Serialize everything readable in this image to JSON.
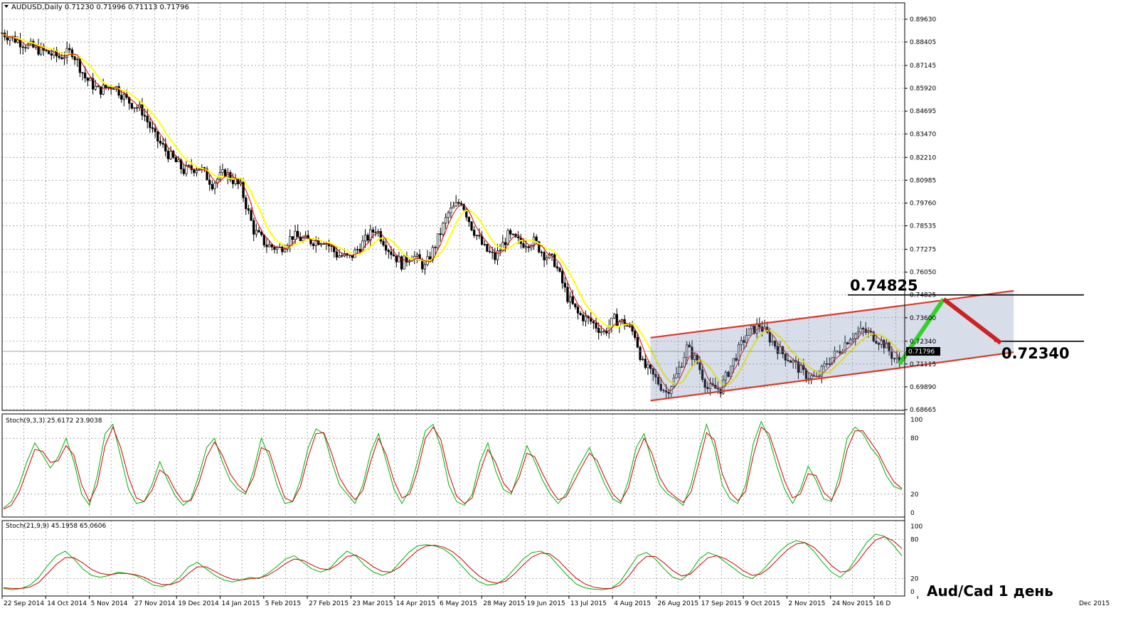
{
  "header": {
    "symbol_line": "AUDUSD,Daily  0.71230 0.71996 0.71113 0.71796"
  },
  "annotation": "Aud/Cad 1 день",
  "chart_data": [
    {
      "type": "candlestick",
      "title": "AUDUSD,Daily",
      "ohlc": [
        0.7123,
        0.71996,
        0.71113,
        0.71796
      ],
      "y_ticks": [
        "0.89630",
        "0.88405",
        "0.87145",
        "0.85920",
        "0.84695",
        "0.83470",
        "0.82210",
        "0.80985",
        "0.79760",
        "0.78535",
        "0.77275",
        "0.76050",
        "0.74825",
        "0.73600",
        "0.72340",
        "0.71115",
        "0.69890",
        "0.68665"
      ],
      "ylim": [
        0.68665,
        0.8963
      ],
      "current_price": "0.71796",
      "x_ticks": [
        "22 Sep 2014",
        "14 Oct 2014",
        "5 Nov 2014",
        "27 Nov 2014",
        "19 Dec 2014",
        "14 Jan 2015",
        "5 Feb 2015",
        "27 Feb 2015",
        "23 Mar 2015",
        "14 Apr 2015",
        "6 May 2015",
        "28 May 2015",
        "19 Jun 2015",
        "13 Jul 2015",
        "4 Aug 2015",
        "26 Aug 2015",
        "17 Sep 2015",
        "9 Oct 2015",
        "2 Nov 2015",
        "24 Nov 2015",
        "16 D",
        "Dec 2015"
      ],
      "price_path": [
        [
          0,
          0.889
        ],
        [
          10,
          0.882
        ],
        [
          16,
          0.879
        ],
        [
          22,
          0.876
        ],
        [
          27,
          0.879
        ],
        [
          32,
          0.865
        ],
        [
          37,
          0.858
        ],
        [
          43,
          0.861
        ],
        [
          48,
          0.853
        ],
        [
          54,
          0.847
        ],
        [
          59,
          0.833
        ],
        [
          64,
          0.824
        ],
        [
          70,
          0.815
        ],
        [
          76,
          0.817
        ],
        [
          81,
          0.808
        ],
        [
          86,
          0.814
        ],
        [
          92,
          0.806
        ],
        [
          97,
          0.783
        ],
        [
          102,
          0.775
        ],
        [
          107,
          0.773
        ],
        [
          112,
          0.78
        ],
        [
          118,
          0.777
        ],
        [
          124,
          0.778
        ],
        [
          129,
          0.77
        ],
        [
          134,
          0.768
        ],
        [
          139,
          0.776
        ],
        [
          144,
          0.784
        ],
        [
          149,
          0.773
        ],
        [
          154,
          0.765
        ],
        [
          158,
          0.77
        ],
        [
          163,
          0.763
        ],
        [
          167,
          0.775
        ],
        [
          172,
          0.792
        ],
        [
          177,
          0.799
        ],
        [
          181,
          0.785
        ],
        [
          186,
          0.773
        ],
        [
          190,
          0.768
        ],
        [
          195,
          0.78
        ],
        [
          200,
          0.776
        ],
        [
          205,
          0.777
        ],
        [
          209,
          0.77
        ],
        [
          213,
          0.766
        ],
        [
          218,
          0.747
        ],
        [
          222,
          0.738
        ],
        [
          227,
          0.734
        ],
        [
          232,
          0.728
        ],
        [
          236,
          0.735
        ],
        [
          240,
          0.733
        ],
        [
          244,
          0.727
        ],
        [
          247,
          0.711
        ],
        [
          252,
          0.703
        ],
        [
          256,
          0.696
        ],
        [
          260,
          0.705
        ],
        [
          264,
          0.72
        ],
        [
          268,
          0.712
        ],
        [
          272,
          0.698
        ],
        [
          277,
          0.698
        ],
        [
          282,
          0.713
        ],
        [
          287,
          0.727
        ],
        [
          292,
          0.732
        ],
        [
          296,
          0.725
        ],
        [
          300,
          0.718
        ],
        [
          305,
          0.712
        ],
        [
          309,
          0.706
        ],
        [
          314,
          0.703
        ],
        [
          318,
          0.712
        ],
        [
          323,
          0.719
        ],
        [
          327,
          0.726
        ],
        [
          332,
          0.729
        ],
        [
          336,
          0.726
        ],
        [
          340,
          0.722
        ],
        [
          344,
          0.714
        ],
        [
          346,
          0.712
        ]
      ],
      "annotations": [
        {
          "label": "0.74825",
          "value": 0.74825
        },
        {
          "label": "0.72340",
          "value": 0.7234
        }
      ],
      "channel": {
        "lower": [
          [
            250,
            0.6915
          ],
          [
            346,
            0.709
          ],
          [
            390,
            0.7175
          ]
        ],
        "upper": [
          [
            250,
            0.7253
          ],
          [
            346,
            0.7423
          ],
          [
            390,
            0.7505
          ]
        ]
      },
      "projection": {
        "up": [
          [
            346,
            0.7112
          ],
          [
            363,
            0.746
          ]
        ],
        "down": [
          [
            363,
            0.746
          ],
          [
            385,
            0.7225
          ]
        ]
      }
    },
    {
      "type": "line",
      "title": "Stoch(9,3,3) 25.6172 23.9038",
      "y_ticks": [
        "100",
        "80",
        "20",
        "0"
      ],
      "ylim": [
        0,
        100
      ],
      "series": [
        {
          "color": "#00b000",
          "values": [
            5,
            12,
            30,
            55,
            75,
            62,
            48,
            60,
            80,
            55,
            20,
            8,
            40,
            85,
            95,
            60,
            25,
            10,
            12,
            30,
            55,
            35,
            18,
            8,
            15,
            40,
            70,
            80,
            55,
            35,
            25,
            20,
            45,
            80,
            60,
            30,
            10,
            12,
            35,
            70,
            90,
            85,
            55,
            30,
            20,
            10,
            30,
            65,
            85,
            55,
            25,
            10,
            25,
            55,
            88,
            95,
            70,
            30,
            12,
            8,
            20,
            55,
            75,
            45,
            25,
            20,
            45,
            72,
            55,
            35,
            20,
            10,
            20,
            40,
            55,
            70,
            50,
            30,
            15,
            10,
            35,
            70,
            85,
            55,
            30,
            20,
            15,
            8,
            30,
            65,
            95,
            70,
            30,
            15,
            10,
            30,
            75,
            98,
            80,
            50,
            25,
            10,
            25,
            50,
            35,
            15,
            12,
            40,
            80,
            92,
            85,
            70,
            60,
            40,
            28,
            25
          ]
        },
        {
          "color": "#cc0000",
          "values": [
            4,
            8,
            22,
            45,
            68,
            66,
            54,
            56,
            72,
            62,
            30,
            12,
            30,
            72,
            92,
            70,
            38,
            16,
            12,
            24,
            46,
            40,
            24,
            12,
            13,
            32,
            60,
            76,
            62,
            42,
            30,
            22,
            38,
            70,
            66,
            40,
            16,
            12,
            28,
            60,
            85,
            86,
            64,
            38,
            24,
            14,
            24,
            55,
            80,
            62,
            34,
            16,
            20,
            45,
            80,
            92,
            78,
            42,
            18,
            10,
            16,
            44,
            68,
            54,
            32,
            22,
            38,
            64,
            60,
            42,
            26,
            14,
            17,
            33,
            49,
            64,
            56,
            37,
            20,
            12,
            27,
            60,
            80,
            64,
            38,
            24,
            17,
            11,
            22,
            53,
            86,
            78,
            42,
            22,
            13,
            23,
            62,
            92,
            85,
            60,
            34,
            16,
            20,
            42,
            40,
            22,
            14,
            31,
            68,
            88,
            88,
            76,
            64,
            47,
            33,
            26
          ]
        }
      ]
    },
    {
      "type": "line",
      "title": "Stoch(21,9,9) 45.1958 65.0606",
      "y_ticks": [
        "100",
        "80",
        "20",
        "0"
      ],
      "ylim": [
        0,
        100
      ],
      "series": [
        {
          "color": "#00b000",
          "values": [
            5,
            3,
            5,
            10,
            22,
            40,
            55,
            62,
            50,
            35,
            25,
            22,
            25,
            30,
            28,
            25,
            18,
            10,
            8,
            12,
            22,
            38,
            45,
            35,
            25,
            18,
            15,
            18,
            22,
            20,
            28,
            38,
            50,
            55,
            45,
            35,
            30,
            35,
            50,
            62,
            55,
            40,
            30,
            25,
            30,
            45,
            60,
            70,
            72,
            70,
            65,
            55,
            40,
            25,
            15,
            10,
            12,
            20,
            35,
            50,
            60,
            62,
            55,
            40,
            25,
            12,
            6,
            4,
            3,
            5,
            15,
            35,
            55,
            60,
            50,
            35,
            22,
            18,
            30,
            50,
            60,
            55,
            45,
            35,
            25,
            20,
            30,
            45,
            60,
            72,
            78,
            75,
            62,
            45,
            30,
            22,
            35,
            55,
            75,
            88,
            85,
            72,
            55
          ]
        },
        {
          "color": "#cc0000",
          "values": [
            6,
            5,
            5,
            7,
            14,
            28,
            42,
            52,
            52,
            44,
            34,
            28,
            26,
            28,
            28,
            26,
            22,
            15,
            11,
            11,
            16,
            28,
            38,
            38,
            31,
            24,
            19,
            18,
            20,
            21,
            25,
            33,
            43,
            50,
            48,
            41,
            35,
            34,
            42,
            54,
            56,
            48,
            38,
            31,
            30,
            38,
            51,
            63,
            70,
            71,
            68,
            61,
            50,
            36,
            24,
            16,
            13,
            16,
            27,
            41,
            53,
            59,
            58,
            48,
            34,
            21,
            12,
            7,
            5,
            5,
            10,
            24,
            42,
            54,
            54,
            44,
            32,
            24,
            27,
            40,
            52,
            55,
            50,
            42,
            32,
            25,
            27,
            37,
            51,
            64,
            73,
            75,
            68,
            55,
            40,
            30,
            32,
            46,
            64,
            79,
            84,
            78,
            66
          ]
        }
      ]
    }
  ]
}
